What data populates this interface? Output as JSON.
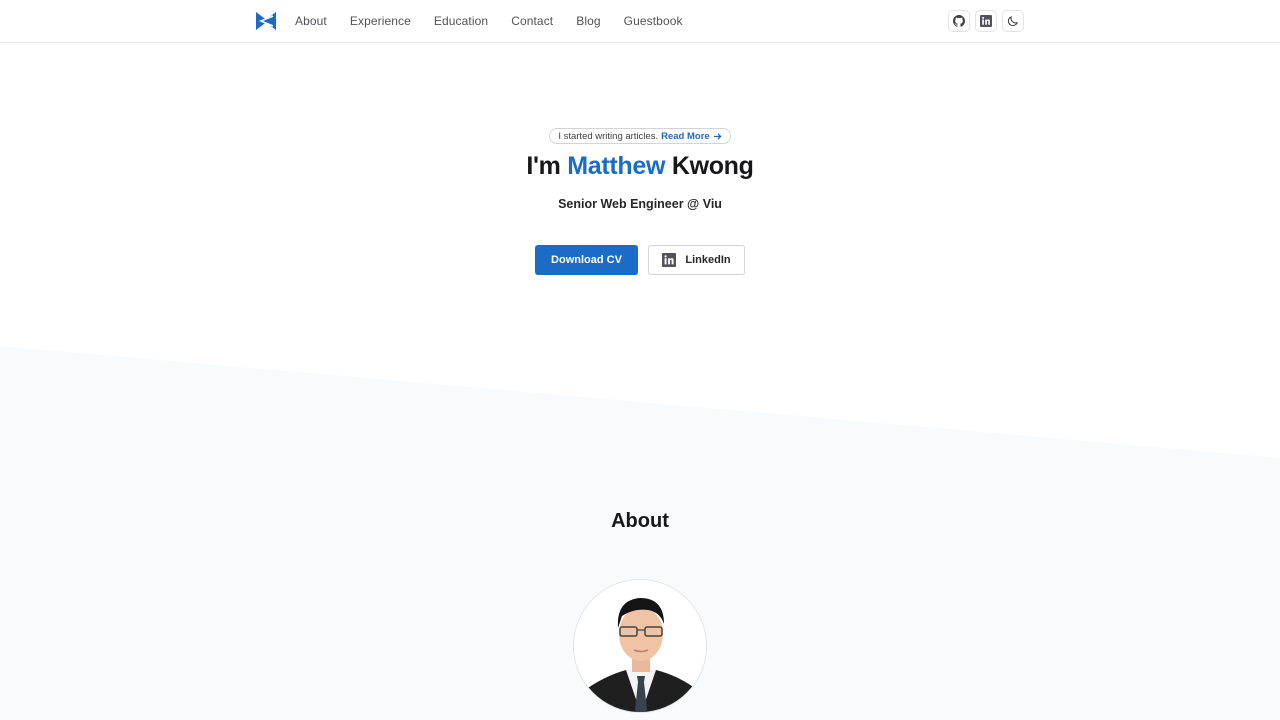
{
  "header": {
    "logo_icon": "mk-logo-icon",
    "nav": [
      {
        "label": "About"
      },
      {
        "label": "Experience"
      },
      {
        "label": "Education"
      },
      {
        "label": "Contact"
      },
      {
        "label": "Blog"
      },
      {
        "label": "Guestbook"
      }
    ],
    "actions": [
      {
        "icon": "github-icon",
        "label": "GitHub"
      },
      {
        "icon": "linkedin-icon",
        "label": "LinkedIn"
      },
      {
        "icon": "moon-icon",
        "label": "Toggle dark mode"
      }
    ]
  },
  "hero": {
    "announcement": {
      "text": "I started writing articles.",
      "link_label": "Read More",
      "link_icon": "arrow-right-icon"
    },
    "title_prefix": "I'm",
    "title_highlight": "Matthew",
    "title_suffix": "Kwong",
    "subtitle": "Senior Web Engineer @ Viu",
    "primary_button": "Download CV",
    "secondary_button": "LinkedIn",
    "secondary_button_icon": "linkedin-icon"
  },
  "about": {
    "title": "About",
    "avatar_alt": "Portrait photo of Matthew Kwong"
  },
  "colors": {
    "accent": "#1a6cc6",
    "text": "#18181b",
    "muted": "#52525b",
    "section_bg": "#f9fafb",
    "border": "#e4e4e7"
  }
}
